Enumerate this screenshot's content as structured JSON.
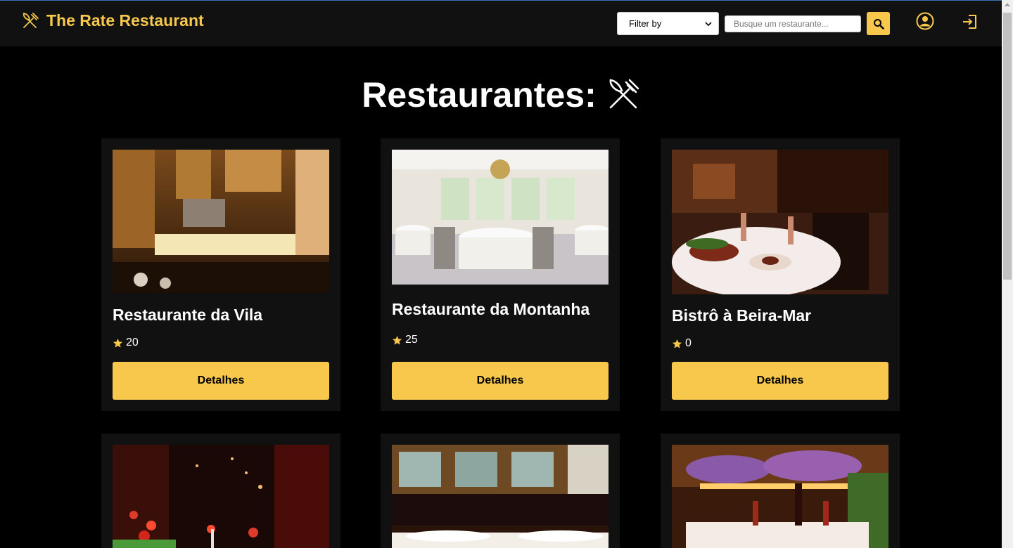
{
  "header": {
    "brand_title": "The Rate Restaurant",
    "filter_label": "Filter by",
    "search_placeholder": "Busque um restaurante...",
    "accent_color": "#f7c84b"
  },
  "main": {
    "title": "Restaurantes:"
  },
  "cards": [
    {
      "name": "Restaurante da Vila",
      "rating": "20",
      "button": "Detalhes",
      "image": "restaurant-wood-interior"
    },
    {
      "name": "Restaurante da Montanha",
      "rating": "25",
      "button": "Detalhes",
      "image": "restaurant-bright-dining-room"
    },
    {
      "name": "Bistrô à Beira-Mar",
      "rating": "0",
      "button": "Detalhes",
      "image": "restaurant-wine-cellar-table"
    },
    {
      "name": "",
      "rating": "",
      "button": "",
      "image": "restaurant-red-lights"
    },
    {
      "name": "",
      "rating": "",
      "button": "",
      "image": "restaurant-bar-mirror"
    },
    {
      "name": "",
      "rating": "",
      "button": "",
      "image": "restaurant-garden-lights"
    }
  ],
  "icons": {
    "brand": "utensils-icon",
    "search": "search-icon",
    "profile": "user-circle-icon",
    "logout": "logout-icon",
    "star": "star-icon"
  }
}
